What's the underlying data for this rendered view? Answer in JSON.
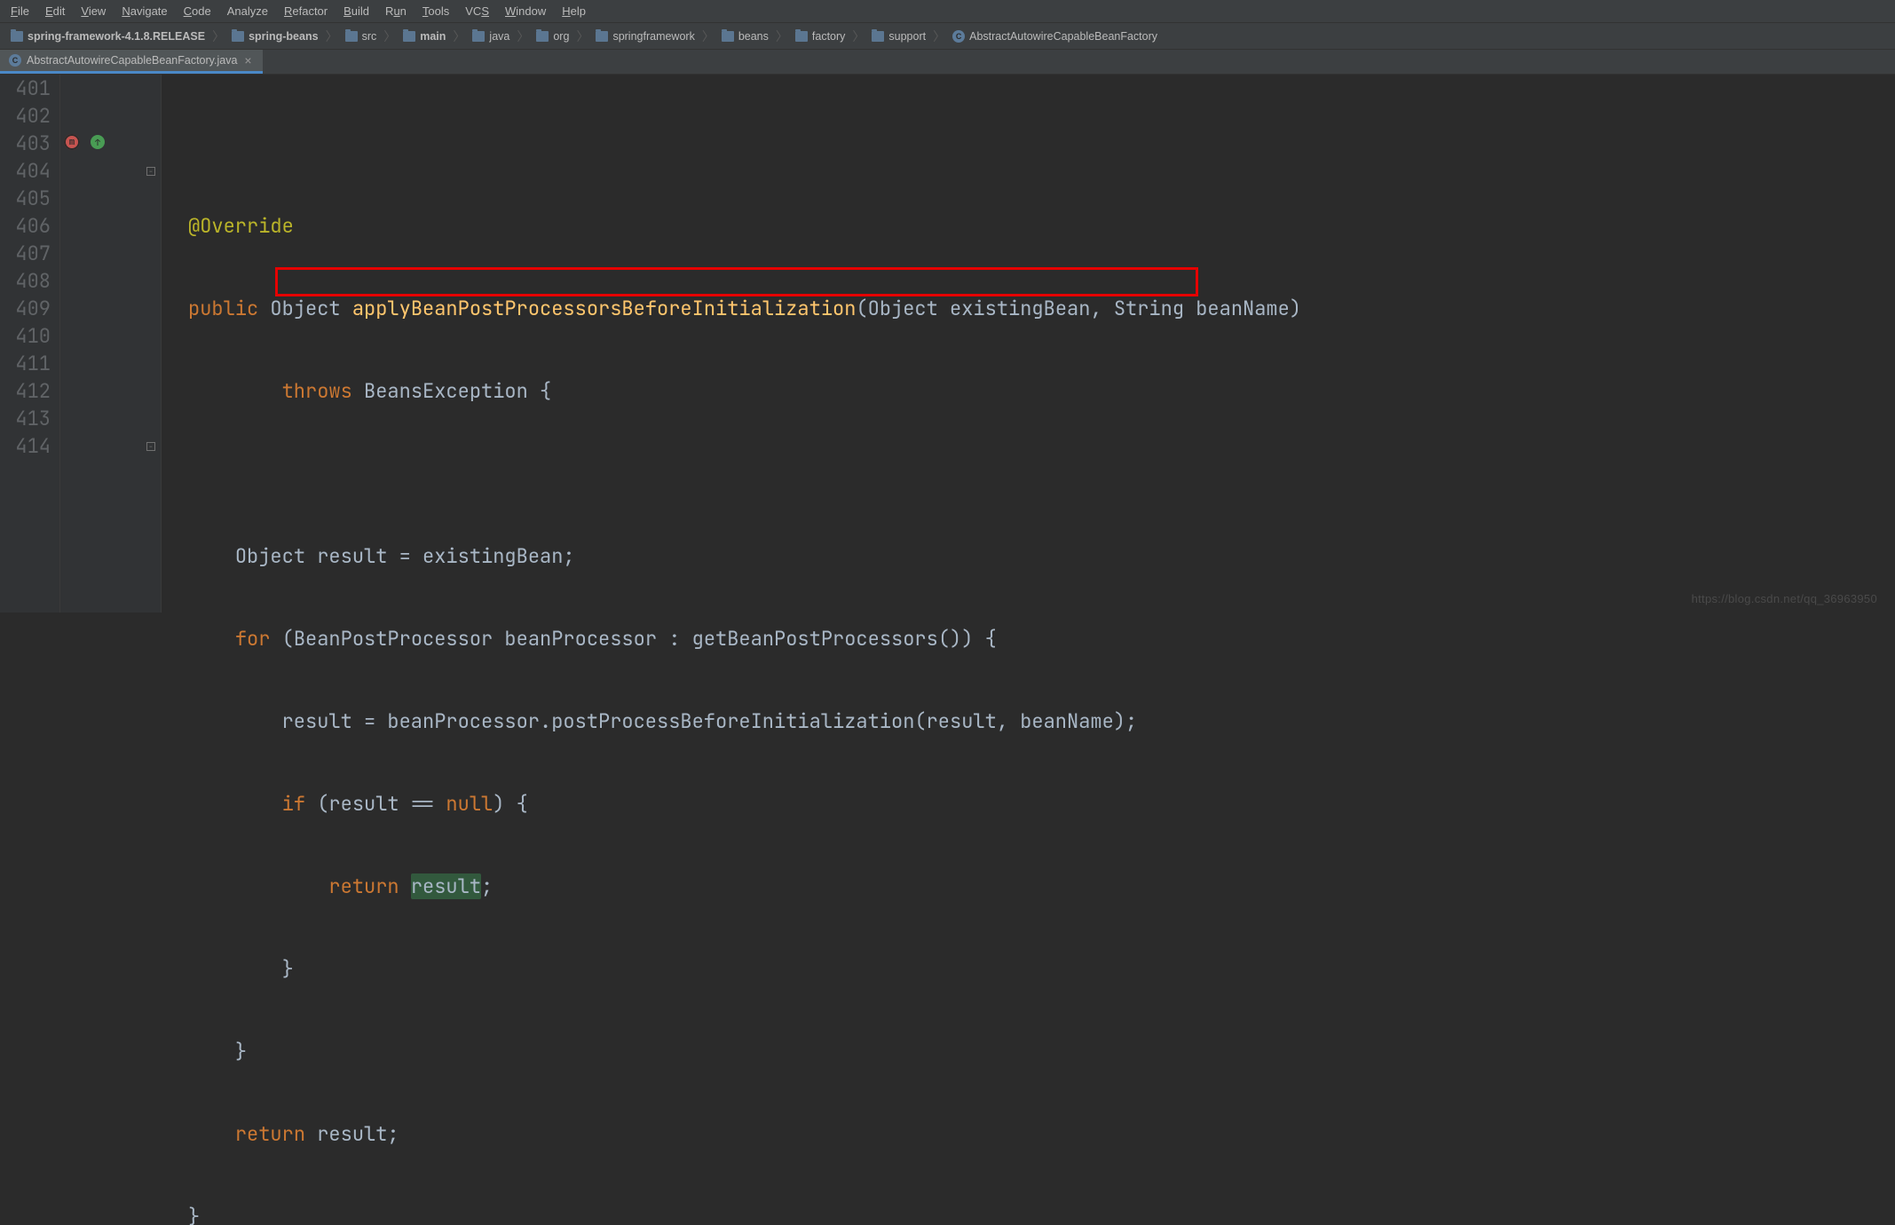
{
  "menu": {
    "file": "File",
    "edit": "Edit",
    "view": "View",
    "navigate": "Navigate",
    "code": "Code",
    "analyze": "Analyze",
    "refactor": "Refactor",
    "build": "Build",
    "run": "Run",
    "tools": "Tools",
    "vcs": "VCS",
    "window": "Window",
    "help": "Help"
  },
  "breadcrumb": {
    "items": [
      {
        "label": "spring-framework-4.1.8.RELEASE",
        "icon": "folder",
        "bold": true
      },
      {
        "label": "spring-beans",
        "icon": "folder",
        "bold": true
      },
      {
        "label": "src",
        "icon": "folder",
        "bold": false
      },
      {
        "label": "main",
        "icon": "folder",
        "bold": true
      },
      {
        "label": "java",
        "icon": "folder",
        "bold": false
      },
      {
        "label": "org",
        "icon": "folder",
        "bold": false
      },
      {
        "label": "springframework",
        "icon": "folder",
        "bold": false
      },
      {
        "label": "beans",
        "icon": "folder",
        "bold": false
      },
      {
        "label": "factory",
        "icon": "folder",
        "bold": false
      },
      {
        "label": "support",
        "icon": "folder",
        "bold": false
      },
      {
        "label": "AbstractAutowireCapableBeanFactory",
        "icon": "class",
        "bold": false
      }
    ]
  },
  "tab": {
    "label": "AbstractAutowireCapableBeanFactory.java",
    "class_letter": "C"
  },
  "gutter": {
    "lines": [
      "401",
      "402",
      "403",
      "404",
      "405",
      "406",
      "407",
      "408",
      "409",
      "410",
      "411",
      "412",
      "413",
      "414"
    ]
  },
  "markers": {
    "red_letter": "m",
    "green_arrow": "↑"
  },
  "code": {
    "l401": "",
    "l402_ann": "@Override",
    "l403_kw1": "public",
    "l403_type": "Object",
    "l403_mth": "applyBeanPostProcessorsBeforeInitialization",
    "l403_params": "(Object existingBean, String beanName)",
    "l404_kw": "throws",
    "l404_rest": " BeansException {",
    "l405": "",
    "l406": "Object result = existingBean;",
    "l407_kw": "for",
    "l407_rest": " (BeanPostProcessor beanProcessor : getBeanPostProcessors()) {",
    "l408": "result = beanProcessor.postProcessBeforeInitialization(result, beanName);",
    "l409_kw": "if",
    "l409_rest1": " (result == ",
    "l409_kw2": "null",
    "l409_rest2": ") {",
    "l410_kw": "return",
    "l410_rest": " ",
    "l410_res": "result",
    "l410_end": ";",
    "l411": "}",
    "l412": "}",
    "l413_kw": "return",
    "l413_rest": " result;",
    "l414": "}"
  },
  "watermark": "https://blog.csdn.net/qq_36963950"
}
